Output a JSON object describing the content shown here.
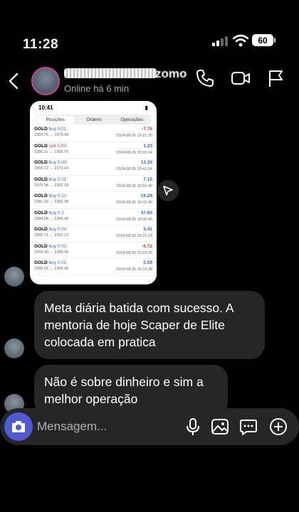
{
  "status": {
    "time": "11:28",
    "battery": "60"
  },
  "header": {
    "name": "zomo",
    "presence": "Online há 6 min"
  },
  "screenshot": {
    "time": "10:41",
    "tabs": [
      "Posições",
      "Ordens",
      "Operações"
    ],
    "trades": [
      {
        "symbol": "GOLD",
        "side": "buy",
        "lot": "0.01",
        "prices": "2384.75 → 2376.99",
        "profit": "-7.76",
        "date": "2024.08.05 19:21:25",
        "neg": true
      },
      {
        "symbol": "GOLD",
        "side": "sell",
        "lot": "0.03",
        "prices": "2366.11 → 2365.70",
        "profit": "1.23",
        "date": "2024.08.05 15:33:14",
        "neg": false
      },
      {
        "symbol": "GOLD",
        "side": "buy",
        "lot": "0.03",
        "prices": "2369.22 → 2373.64",
        "profit": "13.26",
        "date": "2024.08.05 15:41:54",
        "neg": false
      },
      {
        "symbol": "GOLD",
        "side": "buy",
        "lot": "0.01",
        "prices": "2375.08 → 2382.18",
        "profit": "7.10",
        "date": "2024.08.05 16:02:40",
        "neg": false
      },
      {
        "symbol": "GOLD",
        "side": "buy",
        "lot": "0.11",
        "prices": "2381.50 → 2382.98",
        "profit": "16.28",
        "date": "2024.08.05 16:02:49",
        "neg": false
      },
      {
        "symbol": "GOLD",
        "side": "buy",
        "lot": "0.2",
        "prices": "2384.08 → 2386.40",
        "profit": "47.60",
        "date": "2024.08.05 16:05:49",
        "neg": false
      },
      {
        "symbol": "GOLD",
        "side": "buy",
        "lot": "0.01",
        "prices": "2385.71 → 2391.12",
        "profit": "5.41",
        "date": "2024.08.05 16:15:24",
        "neg": false
      },
      {
        "symbol": "GOLD",
        "side": "buy",
        "lot": "0.02",
        "prices": "2393.30 → 2389.99",
        "profit": "-6.72",
        "date": "2024.08.05 16:18:25",
        "neg": true
      },
      {
        "symbol": "GOLD",
        "side": "buy",
        "lot": "0.01",
        "prices": "2389.01 → 2394.60",
        "profit": "5.59",
        "date": "2024.08.05 16:19:38",
        "neg": false
      }
    ]
  },
  "messages": [
    "Meta diária batida com sucesso. A mentoria de hoje Scaper de Elite colocada em pratica",
    "Não é sobre dinheiro e sim a melhor operação"
  ],
  "composer": {
    "placeholder": "Mensagem..."
  }
}
